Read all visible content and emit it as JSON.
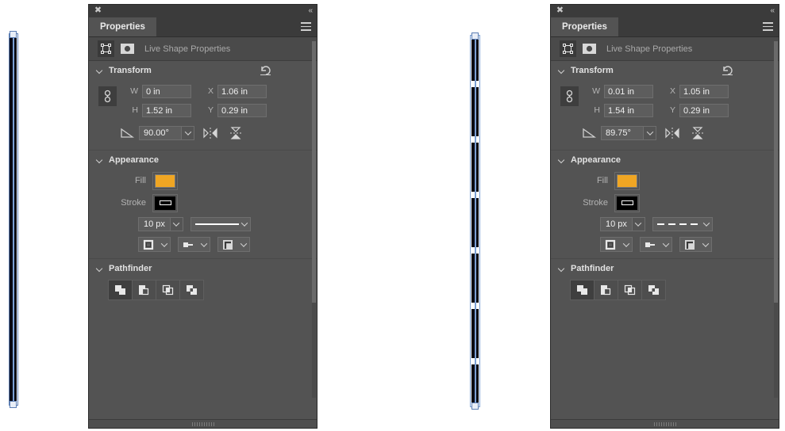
{
  "app": {
    "background": "#ffffff",
    "panel_bg": "#535353",
    "accent_fill": "#F0A623",
    "selection_blue": "#7a9fd4"
  },
  "panels": [
    {
      "id": "left",
      "topbar": {
        "close_label": "✖",
        "collapse_label": "«"
      },
      "tab": {
        "label": "Properties",
        "menu_name": "panel-menu-icon"
      },
      "liveshape": {
        "label": "Live Shape Properties",
        "icon1": "shape-bounds-icon",
        "icon2": "ellipse-shape-icon"
      },
      "transform": {
        "title": "Transform",
        "reset_icon": "reset-icon",
        "link_icon": "link-dimensions-icon",
        "w_label": "W",
        "w_value": "0 in",
        "x_label": "X",
        "x_value": "1.06 in",
        "h_label": "H",
        "h_value": "1.52 in",
        "y_label": "Y",
        "y_value": "0.29 in",
        "angle_value": "90.00°",
        "flip_h": "flip-horizontal-icon",
        "flip_v": "flip-vertical-icon"
      },
      "appearance": {
        "title": "Appearance",
        "fill_label": "Fill",
        "fill_color": "#F0A623",
        "stroke_label": "Stroke",
        "stroke_color": "#ffffff",
        "stroke_width": "10 px",
        "dash_style": "solid",
        "align_icon": "stroke-align-icon",
        "cap_icon": "stroke-cap-icon",
        "join_icon": "stroke-join-icon"
      },
      "pathfinder": {
        "title": "Pathfinder",
        "buttons": [
          "unite-icon",
          "minus-front-icon",
          "intersect-icon",
          "exclude-icon"
        ]
      }
    },
    {
      "id": "right",
      "topbar": {
        "close_label": "✖",
        "collapse_label": "«"
      },
      "tab": {
        "label": "Properties",
        "menu_name": "panel-menu-icon"
      },
      "liveshape": {
        "label": "Live Shape Properties",
        "icon1": "shape-bounds-icon",
        "icon2": "ellipse-shape-icon"
      },
      "transform": {
        "title": "Transform",
        "reset_icon": "reset-icon",
        "link_icon": "link-dimensions-icon",
        "w_label": "W",
        "w_value": "0.01 in",
        "x_label": "X",
        "x_value": "1.05 in",
        "h_label": "H",
        "h_value": "1.54 in",
        "y_label": "Y",
        "y_value": "0.29 in",
        "angle_value": "89.75°",
        "flip_h": "flip-horizontal-icon",
        "flip_v": "flip-vertical-icon"
      },
      "appearance": {
        "title": "Appearance",
        "fill_label": "Fill",
        "fill_color": "#F0A623",
        "stroke_label": "Stroke",
        "stroke_color": "#ffffff",
        "stroke_width": "10 px",
        "dash_style": "dash-dot",
        "align_icon": "stroke-align-icon",
        "cap_icon": "stroke-cap-icon",
        "join_icon": "stroke-join-icon"
      },
      "pathfinder": {
        "title": "Pathfinder",
        "buttons": [
          "unite-icon",
          "minus-front-icon",
          "intersect-icon",
          "exclude-icon"
        ]
      }
    }
  ],
  "canvas": {
    "left_shape": {
      "name": "vertical-line-solid",
      "stroke_color": "#0b0b14"
    },
    "middle_shape": {
      "name": "vertical-line-dashed",
      "stroke_color": "#0b0b14"
    }
  }
}
